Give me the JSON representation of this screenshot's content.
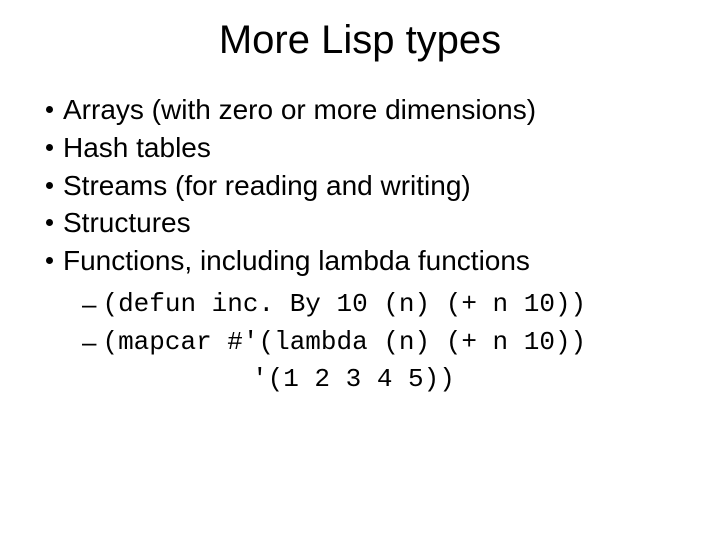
{
  "title": "More Lisp types",
  "bullets": {
    "b0": "Arrays (with zero or more dimensions)",
    "b1": "Hash tables",
    "b2": "Streams (for reading and writing)",
    "b3": "Structures",
    "b4": "Functions, including lambda functions"
  },
  "subs": {
    "s0": "(defun inc. By 10 (n) (+ n 10))",
    "s1": "(mapcar #'(lambda (n) (+ n 10))",
    "s1_cont": "'(1 2 3 4 5))"
  },
  "glyphs": {
    "dash": "–"
  }
}
